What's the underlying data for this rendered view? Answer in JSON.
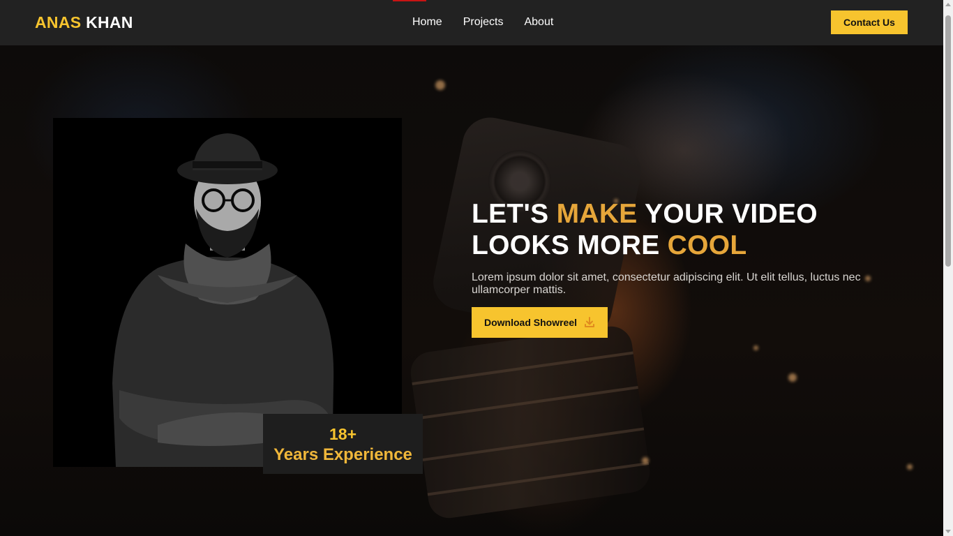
{
  "header": {
    "logo_first": "ANAS",
    "logo_second": "KHAN",
    "nav": [
      {
        "label": "Home"
      },
      {
        "label": "Projects"
      },
      {
        "label": "About"
      }
    ],
    "contact_label": "Contact Us"
  },
  "hero": {
    "headline": {
      "part1": "LET'S ",
      "highlight1": "MAKE",
      "part2": " YOUR VIDEO",
      "part3": "LOOKS MORE ",
      "highlight2": "COOL"
    },
    "lead": "Lorem ipsum dolor sit amet, consectetur adipiscing elit. Ut elit tellus, luctus nec ullamcorper mattis.",
    "cta_label": "Download Showreel",
    "cta_icon": "download-icon"
  },
  "experience": {
    "value": "18+",
    "label": "Years Experience"
  },
  "colors": {
    "accent": "#f7c42e",
    "accent_text": "#e6a63a",
    "header_bg": "#222222",
    "badge_bg": "#1e1e1e"
  }
}
